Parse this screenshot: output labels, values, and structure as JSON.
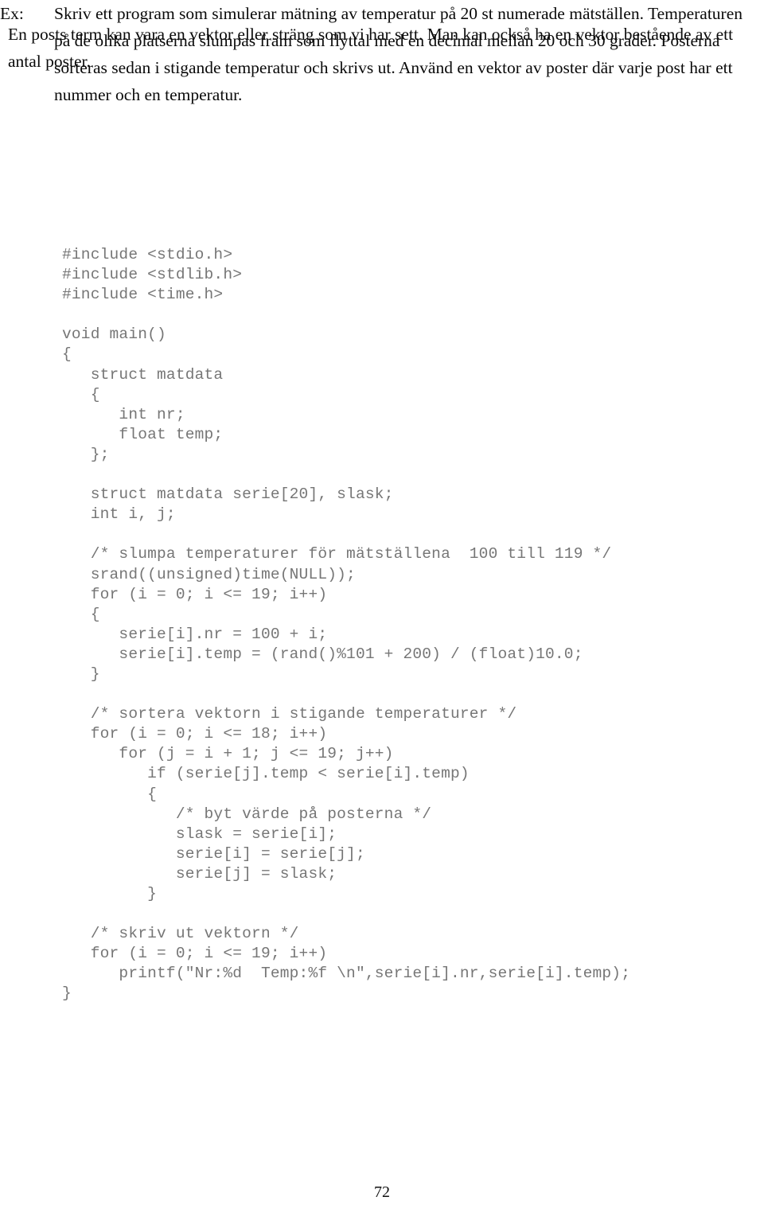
{
  "document": {
    "intro_paragraph": "En posts term kan vara en vektor eller sträng som vi har sett. Man kan också ha en vektor bestående av ett antal poster.",
    "example": {
      "label": "Ex:",
      "text": "Skriv ett program som simulerar mätning av temperatur på 20 st numerade mätställen. Temperaturen på de olika platserna slumpas fram som flyttal med en decimal mellan 20 och 30 grader. Posterna  sorteras sedan i stigande temperatur och skrivs ut. Använd en vektor av poster där varje post har ett nummer och en temperatur."
    },
    "code_listing": "#include <stdio.h>\n#include <stdlib.h>\n#include <time.h>\n\nvoid main()\n{\n   struct matdata\n   {\n      int nr;\n      float temp;\n   };\n\n   struct matdata serie[20], slask;\n   int i, j;\n\n   /* slumpa temperaturer för mätställena  100 till 119 */\n   srand((unsigned)time(NULL));\n   for (i = 0; i <= 19; i++)\n   {\n      serie[i].nr = 100 + i;\n      serie[i].temp = (rand()%101 + 200) / (float)10.0;\n   }\n\n   /* sortera vektorn i stigande temperaturer */\n   for (i = 0; i <= 18; i++)\n      for (j = i + 1; j <= 19; j++)\n         if (serie[j].temp < serie[i].temp)\n         {\n            /* byt värde på posterna */\n            slask = serie[i];\n            serie[i] = serie[j];\n            serie[j] = slask;\n         }\n\n   /* skriv ut vektorn */\n   for (i = 0; i <= 19; i++)\n      printf(\"Nr:%d  Temp:%f \\n\",serie[i].nr,serie[i].temp);\n}",
    "page_number": "72",
    "colors": {
      "body_text": "#0a0a0a",
      "code_text": "#767676",
      "background": "#ffffff"
    }
  }
}
